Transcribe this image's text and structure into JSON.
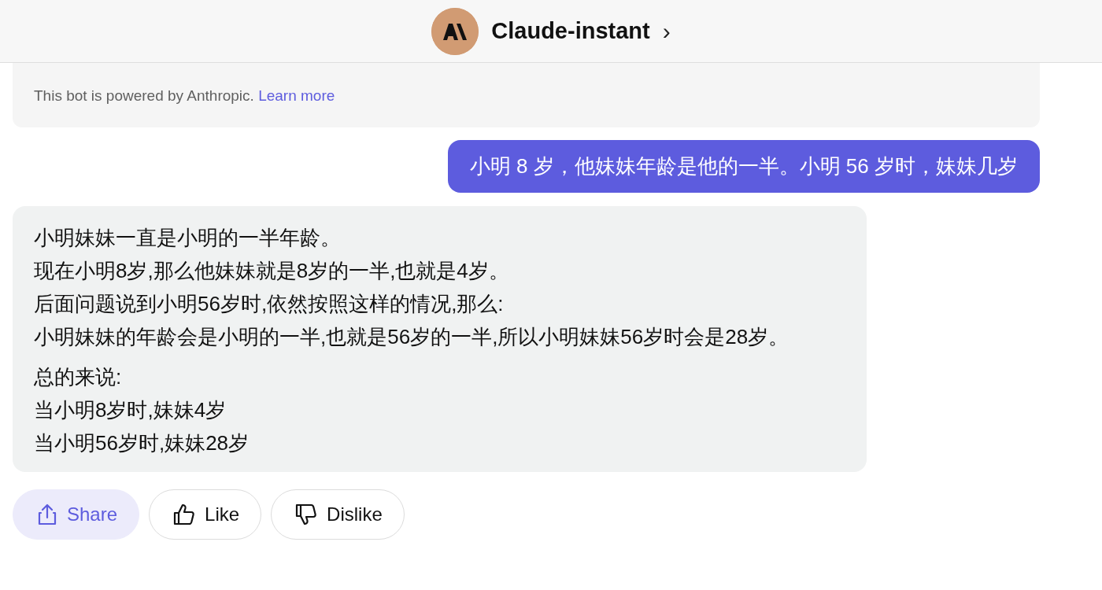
{
  "header": {
    "title": "Claude-instant",
    "chevron": "›"
  },
  "notice": {
    "text": "This bot is powered by Anthropic.",
    "link": "Learn more"
  },
  "messages": [
    {
      "kind": "user",
      "paragraphs": [
        [
          "小明 8 岁，他妹妹年龄是他的一半。小明 56 岁时，妹妹几岁"
        ]
      ]
    },
    {
      "kind": "bot",
      "paragraphs": [
        [
          "小明妹妹一直是小明的一半年龄。",
          "现在小明8岁,那么他妹妹就是8岁的一半,也就是4岁。",
          "后面问题说到小明56岁时,依然按照这样的情况,那么:",
          "小明妹妹的年龄会是小明的一半,也就是56岁的一半,所以小明妹妹56岁时会是28岁。"
        ],
        [
          "总的来说:",
          "当小明8岁时,妹妹4岁",
          "当小明56岁时,妹妹28岁"
        ]
      ]
    }
  ],
  "actions": [
    {
      "kind": "share",
      "label": "Share"
    },
    {
      "kind": "like",
      "label": "Like"
    },
    {
      "kind": "dislike",
      "label": "Dislike"
    }
  ]
}
